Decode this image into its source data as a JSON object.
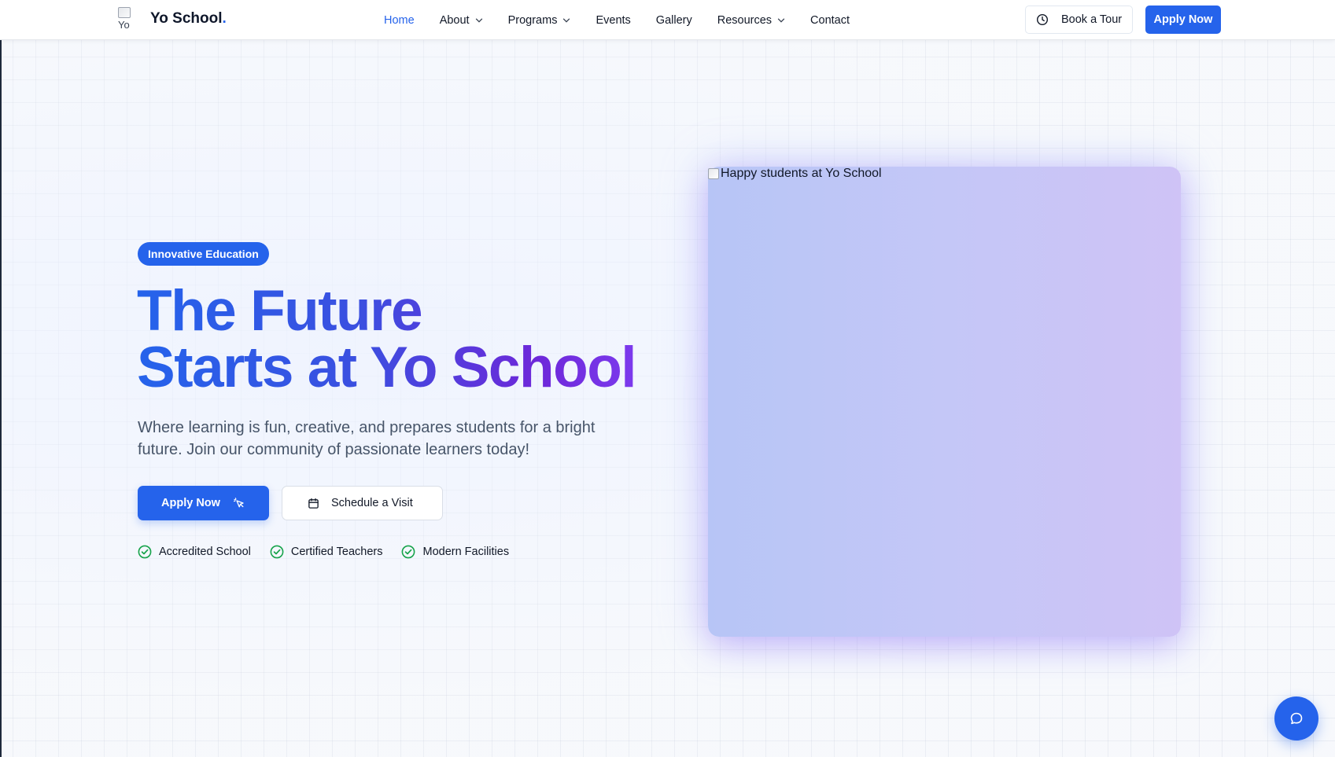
{
  "brand": {
    "logo_alt": "Yo",
    "name": "Yo School",
    "dot": ".",
    "accent": "#2563eb"
  },
  "nav": {
    "items": [
      {
        "label": "Home",
        "active": true,
        "dropdown": false
      },
      {
        "label": "About",
        "active": false,
        "dropdown": true
      },
      {
        "label": "Programs",
        "active": false,
        "dropdown": true
      },
      {
        "label": "Events",
        "active": false,
        "dropdown": false
      },
      {
        "label": "Gallery",
        "active": false,
        "dropdown": false
      },
      {
        "label": "Resources",
        "active": false,
        "dropdown": true
      },
      {
        "label": "Contact",
        "active": false,
        "dropdown": false
      }
    ],
    "book_tour": "Book a Tour",
    "apply": "Apply Now"
  },
  "hero": {
    "badge": "Innovative Education",
    "headline_line1": "The Future",
    "headline_line2": "Starts at Yo School",
    "lead": "Where learning is fun, creative, and prepares students for a bright future. Join our community of passionate learners today!",
    "cta_apply": "Apply Now",
    "cta_visit": "Schedule a Visit",
    "features": [
      "Accredited School",
      "Certified Teachers",
      "Modern Facilities"
    ],
    "image_alt": "Happy students at Yo School"
  },
  "colors": {
    "primary": "#2563eb",
    "gradient_end": "#7c3aed",
    "check": "#16a34a"
  },
  "icons": {
    "book_tour": "clock-icon",
    "cta_apply": "cursor-click-icon",
    "cta_visit": "calendar-icon",
    "feature": "check-circle-icon",
    "chat": "chat-bubble-icon",
    "dropdown": "chevron-down-icon"
  }
}
